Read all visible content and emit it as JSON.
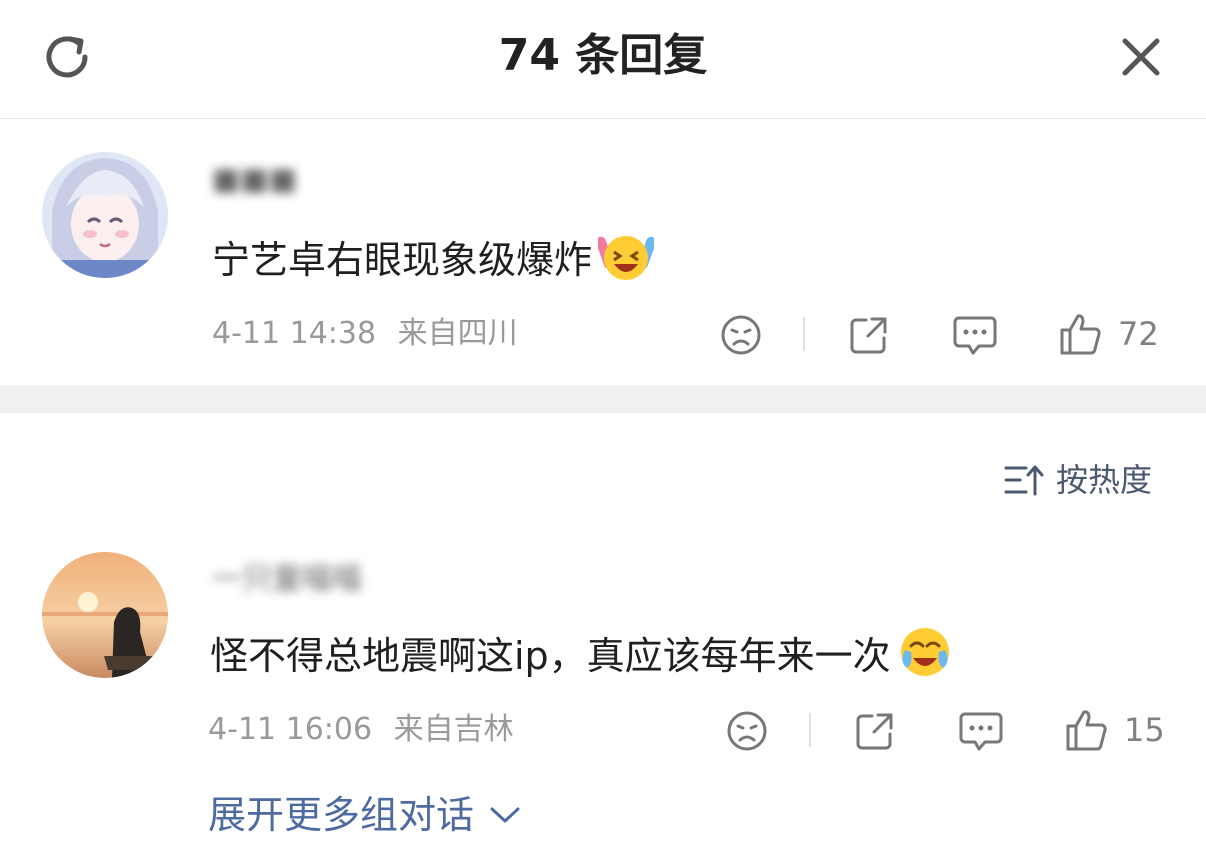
{
  "header": {
    "title": "74 条回复"
  },
  "main_comment": {
    "username": "■■■",
    "text": "宁艺卓右眼现象级爆炸",
    "timestamp": "4-11 14:38",
    "location": "来自四川",
    "likes": "72",
    "emoji": "laughing-tears-emoji"
  },
  "sort": {
    "label": "按热度"
  },
  "reply": {
    "username": "一只童喵喵",
    "text": "怪不得总地震啊这ip，真应该每年来一次",
    "timestamp": "4-11 16:06",
    "location": "来自吉林",
    "likes": "15",
    "emoji": "crying-laughing-emoji"
  },
  "expand": {
    "label": "展开更多组对话"
  },
  "colors": {
    "accent_link": "#4d6ba0",
    "meta_gray": "#9a9a9a",
    "separator": "#f0f0f0"
  }
}
